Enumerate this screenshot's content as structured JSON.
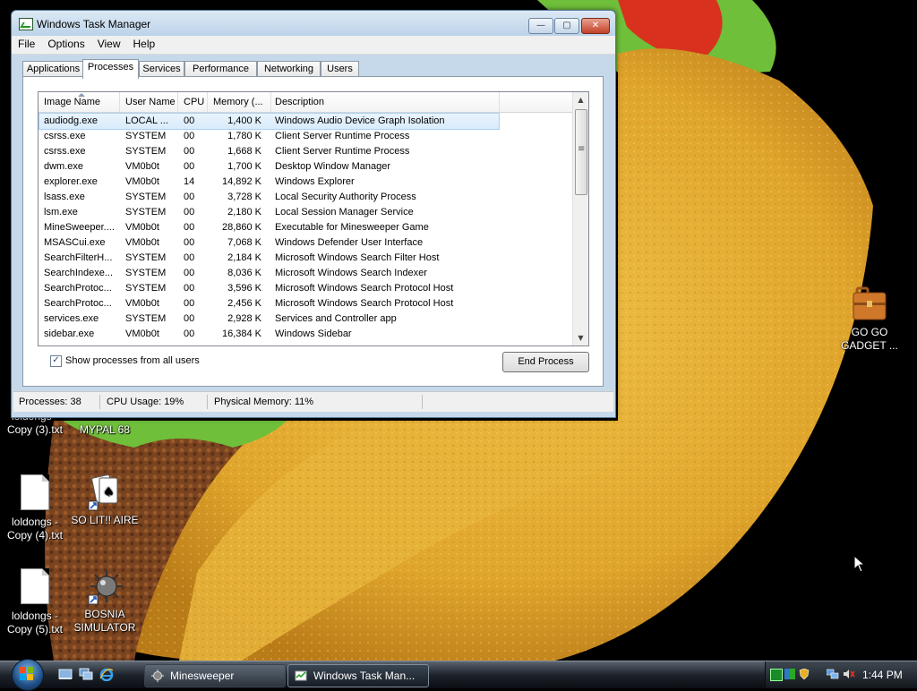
{
  "window": {
    "title": "Windows Task Manager",
    "controls": {
      "minimize": "—",
      "maximize": "▢",
      "close": "✕"
    },
    "menu": [
      "File",
      "Options",
      "View",
      "Help"
    ],
    "tabs": [
      "Applications",
      "Processes",
      "Services",
      "Performance",
      "Networking",
      "Users"
    ],
    "active_tab": "Processes",
    "columns": [
      "Image Name",
      "User Name",
      "CPU",
      "Memory (...",
      "Description"
    ],
    "processes": [
      {
        "name": "audiodg.exe",
        "user": "LOCAL ...",
        "cpu": "00",
        "mem": "1,400 K",
        "desc": "Windows Audio Device Graph Isolation"
      },
      {
        "name": "csrss.exe",
        "user": "SYSTEM",
        "cpu": "00",
        "mem": "1,780 K",
        "desc": "Client Server Runtime Process"
      },
      {
        "name": "csrss.exe",
        "user": "SYSTEM",
        "cpu": "00",
        "mem": "1,668 K",
        "desc": "Client Server Runtime Process"
      },
      {
        "name": "dwm.exe",
        "user": "VM0b0t",
        "cpu": "00",
        "mem": "1,700 K",
        "desc": "Desktop Window Manager"
      },
      {
        "name": "explorer.exe",
        "user": "VM0b0t",
        "cpu": "14",
        "mem": "14,892 K",
        "desc": "Windows Explorer"
      },
      {
        "name": "lsass.exe",
        "user": "SYSTEM",
        "cpu": "00",
        "mem": "3,728 K",
        "desc": "Local Security Authority Process"
      },
      {
        "name": "lsm.exe",
        "user": "SYSTEM",
        "cpu": "00",
        "mem": "2,180 K",
        "desc": "Local Session Manager Service"
      },
      {
        "name": "MineSweeper....",
        "user": "VM0b0t",
        "cpu": "00",
        "mem": "28,860 K",
        "desc": "Executable for Minesweeper Game"
      },
      {
        "name": "MSASCui.exe",
        "user": "VM0b0t",
        "cpu": "00",
        "mem": "7,068 K",
        "desc": "Windows Defender User Interface"
      },
      {
        "name": "SearchFilterH...",
        "user": "SYSTEM",
        "cpu": "00",
        "mem": "2,184 K",
        "desc": "Microsoft Windows Search Filter Host"
      },
      {
        "name": "SearchIndexe...",
        "user": "SYSTEM",
        "cpu": "00",
        "mem": "8,036 K",
        "desc": "Microsoft Windows Search Indexer"
      },
      {
        "name": "SearchProtoc...",
        "user": "SYSTEM",
        "cpu": "00",
        "mem": "3,596 K",
        "desc": "Microsoft Windows Search Protocol Host"
      },
      {
        "name": "SearchProtoc...",
        "user": "VM0b0t",
        "cpu": "00",
        "mem": "2,456 K",
        "desc": "Microsoft Windows Search Protocol Host"
      },
      {
        "name": "services.exe",
        "user": "SYSTEM",
        "cpu": "00",
        "mem": "2,928 K",
        "desc": "Services and Controller app"
      },
      {
        "name": "sidebar.exe",
        "user": "VM0b0t",
        "cpu": "00",
        "mem": "16,384 K",
        "desc": "Windows Sidebar"
      }
    ],
    "show_all_label": "Show processes from all users",
    "show_all_checked": true,
    "end_process_label": "End Process",
    "status": {
      "processes": "Processes: 38",
      "cpu": "CPU Usage: 19%",
      "memory": "Physical Memory: 11%"
    }
  },
  "desktop_icons": [
    {
      "id": "go-go-gadget",
      "line1": "GO GO",
      "line2": "GADGET ..."
    },
    {
      "id": "loldongs-3",
      "line1": "loldongs -",
      "line2": "Copy (3).txt"
    },
    {
      "id": "mypal",
      "line1": "MYPAL 68",
      "line2": ""
    },
    {
      "id": "loldongs-4",
      "line1": "loldongs -",
      "line2": "Copy (4).txt"
    },
    {
      "id": "so-lit-aire",
      "line1": "SO LIT!! AIRE",
      "line2": ""
    },
    {
      "id": "loldongs-5",
      "line1": "loldongs -",
      "line2": "Copy (5).txt"
    },
    {
      "id": "bosnia",
      "line1": "BOSNIA",
      "line2": "SIMULATOR"
    }
  ],
  "taskbar": {
    "buttons": [
      {
        "label": "Minesweeper",
        "active": false
      },
      {
        "label": "Windows Task Man...",
        "active": true
      }
    ],
    "clock": "1:44 PM"
  },
  "colors": {
    "taco_shell": "#e8b53a",
    "taco_shell_dark": "#c98a1e",
    "beef": "#7a4420",
    "lettuce": "#6fbf3a",
    "tomato": "#d8321e",
    "window_frame": "#c6d9ea",
    "selection": "#d9ebfb"
  }
}
